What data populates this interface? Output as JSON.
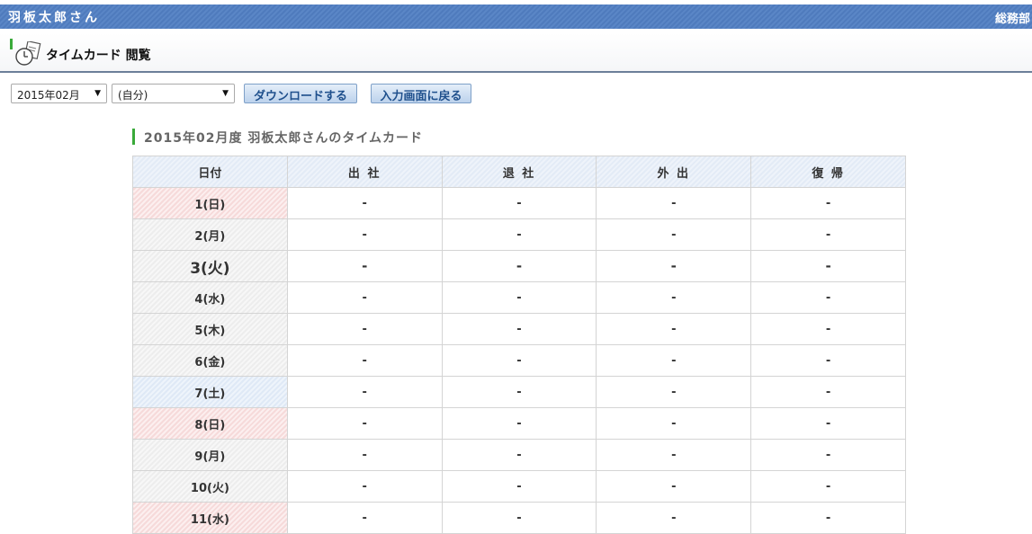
{
  "header": {
    "user_name": "羽板太郎さん",
    "department": "総務部"
  },
  "section": {
    "title": "タイムカード 閲覧"
  },
  "controls": {
    "month_select": "2015年02月",
    "person_select": "(自分)",
    "download_button": "ダウンロードする",
    "back_button": "入力画面に戻る"
  },
  "timecard": {
    "caption": "2015年02月度 羽板太郎さんのタイムカード",
    "columns": [
      "日付",
      "出 社",
      "退 社",
      "外 出",
      "復 帰"
    ],
    "rows": [
      {
        "date": "1(日)",
        "in": "-",
        "out": "-",
        "away": "-",
        "return": "-"
      },
      {
        "date": "2(月)",
        "in": "-",
        "out": "-",
        "away": "-",
        "return": "-"
      },
      {
        "date": "3(火)",
        "in": "-",
        "out": "-",
        "away": "-",
        "return": "-"
      },
      {
        "date": "4(水)",
        "in": "-",
        "out": "-",
        "away": "-",
        "return": "-"
      },
      {
        "date": "5(木)",
        "in": "-",
        "out": "-",
        "away": "-",
        "return": "-"
      },
      {
        "date": "6(金)",
        "in": "-",
        "out": "-",
        "away": "-",
        "return": "-"
      },
      {
        "date": "7(土)",
        "in": "-",
        "out": "-",
        "away": "-",
        "return": "-"
      },
      {
        "date": "8(日)",
        "in": "-",
        "out": "-",
        "away": "-",
        "return": "-"
      },
      {
        "date": "9(月)",
        "in": "-",
        "out": "-",
        "away": "-",
        "return": "-"
      },
      {
        "date": "10(火)",
        "in": "-",
        "out": "-",
        "away": "-",
        "return": "-"
      },
      {
        "date": "11(水)",
        "in": "-",
        "out": "-",
        "away": "-",
        "return": "-"
      }
    ]
  },
  "icons": {
    "section_icon": "clock-timecard-icon",
    "dropdown": "triangle-down-icon"
  },
  "colors": {
    "header_bar": "#4f7bbd",
    "button_text": "#1e4f8c",
    "accent_green": "#3aaa3a",
    "sunday": "#f6dada",
    "saturday": "#dfe9f6"
  }
}
